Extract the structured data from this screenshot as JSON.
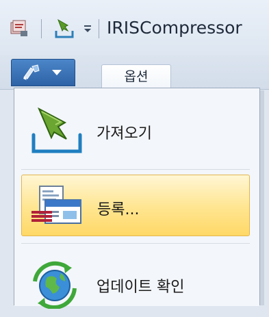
{
  "window": {
    "title": "IRISCompressor",
    "app_icon": "iris-app-icon",
    "quick_access": {
      "import_icon": "import-tray-icon",
      "dropdown_icon": "customize-dropdown-icon"
    }
  },
  "ribbon": {
    "app_button_icon": "application-menu-icon",
    "tabs": [
      {
        "label": "옵션"
      }
    ]
  },
  "app_menu": {
    "items": [
      {
        "label": "가져오기",
        "icon": "import-tray-icon",
        "highlighted": false
      },
      {
        "label": "등록...",
        "icon": "registration-card-icon",
        "highlighted": true
      },
      {
        "label": "업데이트 확인",
        "icon": "update-globe-icon",
        "highlighted": false
      }
    ]
  },
  "colors": {
    "highlight_top": "#fff6d4",
    "highlight_bottom": "#ffd867",
    "app_button": "#2e62a6"
  }
}
